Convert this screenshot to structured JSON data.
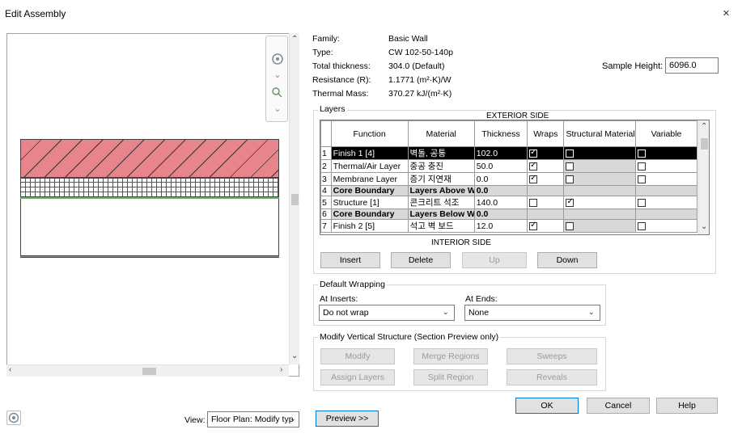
{
  "window": {
    "title": "Edit Assembly",
    "close_label": "×"
  },
  "info": {
    "family_label": "Family:",
    "family": "Basic Wall",
    "type_label": "Type:",
    "type": "CW 102-50-140p",
    "thickness_label": "Total thickness:",
    "thickness": "304.0 (Default)",
    "resistance_label": "Resistance (R):",
    "resistance": "1.1771 (m²·K)/W",
    "mass_label": "Thermal Mass:",
    "mass": "370.27 kJ/(m²·K)"
  },
  "sample_height": {
    "label": "Sample Height:",
    "value": "6096.0"
  },
  "layers": {
    "group_title": "Layers",
    "exterior_label": "EXTERIOR SIDE",
    "interior_label": "INTERIOR SIDE",
    "columns": [
      "Function",
      "Material",
      "Thickness",
      "Wraps",
      "Structural Material",
      "Variable"
    ],
    "rows": [
      {
        "num": "1",
        "function": "Finish 1 [4]",
        "material": "벽돌, 공통",
        "thickness": "102.0",
        "wraps": true,
        "structural": false,
        "variable": false,
        "style": "sel"
      },
      {
        "num": "2",
        "function": "Thermal/Air Layer",
        "material": "중공 충진",
        "thickness": "50.0",
        "wraps": true,
        "structural": false,
        "variable": false,
        "style": ""
      },
      {
        "num": "3",
        "function": "Membrane Layer",
        "material": "증기 지연재",
        "thickness": "0.0",
        "wraps": true,
        "structural": false,
        "variable": false,
        "style": ""
      },
      {
        "num": "4",
        "function": "Core Boundary",
        "material": "Layers Above W",
        "thickness": "0.0",
        "wraps": null,
        "structural": null,
        "variable": null,
        "style": "core"
      },
      {
        "num": "5",
        "function": "Structure [1]",
        "material": "콘크리트 석조",
        "thickness": "140.0",
        "wraps": false,
        "structural": true,
        "variable": false,
        "style": ""
      },
      {
        "num": "6",
        "function": "Core Boundary",
        "material": "Layers Below W",
        "thickness": "0.0",
        "wraps": null,
        "structural": null,
        "variable": null,
        "style": "core"
      },
      {
        "num": "7",
        "function": "Finish 2 [5]",
        "material": "석고 벽 보드",
        "thickness": "12.0",
        "wraps": true,
        "structural": false,
        "variable": false,
        "style": ""
      }
    ],
    "buttons": {
      "insert": "Insert",
      "delete": "Delete",
      "up": "Up",
      "down": "Down"
    }
  },
  "wrapping": {
    "group_title": "Default Wrapping",
    "inserts_label": "At Inserts:",
    "inserts_value": "Do not wrap",
    "ends_label": "At Ends:",
    "ends_value": "None"
  },
  "vertical": {
    "group_title": "Modify Vertical Structure (Section Preview only)",
    "modify": "Modify",
    "merge": "Merge Regions",
    "sweeps": "Sweeps",
    "assign": "Assign Layers",
    "split": "Split Region",
    "reveals": "Reveals"
  },
  "footer": {
    "ok": "OK",
    "cancel": "Cancel",
    "help": "Help",
    "view_label": "View:",
    "view_value": "Floor Plan: Modify typ",
    "preview": "Preview >>"
  }
}
